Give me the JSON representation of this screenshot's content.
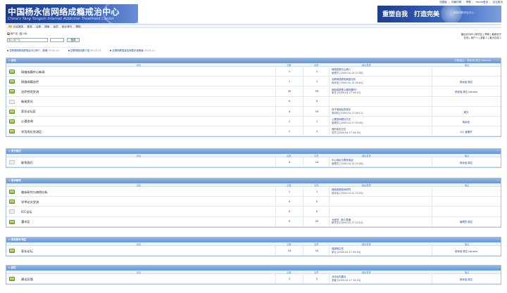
{
  "header": {
    "top_links": [
      "无图版",
      "风格切换",
      "帮助",
      "Home首页",
      "论坛首页"
    ],
    "banner_title": "中国杨永信网络成瘾戒治中心",
    "banner_subtitle": "China's Yang Yongxin Internet Addiction Treatment Center",
    "slogan_main": "重塑自我　打造完美",
    "slogan_small": "网络成瘾戒治中心"
  },
  "nav": {
    "items": [
      "社区服务",
      "登录",
      "注册",
      "搜索",
      "会员",
      "统计排行",
      "帮助"
    ]
  },
  "login": {
    "radio_user": "用户名",
    "radio_uid": "UID",
    "username_placeholder": "输入用户名",
    "login_button": "登录"
  },
  "stats": {
    "line1": "最后访问IP:| 精华区 | 帮助 | 最新帖子",
    "line2": "在线 | 用户 0 | 游客 1 | 最大在线 1"
  },
  "announcements": [
    {
      "text": "互联网网络成瘾戒治中心简介，新增",
      "date": "09-04-13"
    },
    {
      "text": "互联网络成瘾介绍",
      "date": "09-04-13"
    },
    {
      "text": "互联网瘾患者及家属必读报道",
      "date": "09-04-13"
    }
  ],
  "columns": {
    "forum": "论坛",
    "topics": "主题",
    "posts": "文章",
    "last_post": "最后发表",
    "moderator": "版主"
  },
  "sections": [
    {
      "title": "» 论坛",
      "mods": "分类版主：杨永信 周文 hahaha",
      "rows": [
        {
          "icon": "new",
          "name": "网络成瘾中心新闻",
          "topics": "1",
          "posts": "1",
          "last_title": "网络成瘾中心简介",
          "last_by": "管理员 [2009-04-13 15:58]",
          "moderator": ""
        },
        {
          "icon": "new",
          "name": "网络成瘾治疗",
          "topics": "1",
          "posts": "1",
          "last_title": "互联网成瘾的病因分析",
          "last_by": "杨永信 [2009-04-13 16:02]",
          "moderator": "杨永信 周文"
        },
        {
          "icon": "new",
          "name": "治疗经验交流",
          "topics": "32",
          "posts": "53",
          "last_title": "网络成瘾是心理问题吗？",
          "last_by": "家长 [2009-04-17 09:25]",
          "moderator": "杨永信 周文 hahaha"
        },
        {
          "icon": "old",
          "name": "新闻资讯",
          "topics": "0",
          "posts": "0",
          "last_title": "",
          "last_by": "",
          "moderator": ""
        },
        {
          "icon": "new",
          "name": "家长论坛区",
          "topics": "4",
          "posts": "19",
          "last_title": "孩子戒网后的变化",
          "last_by": "张妈妈 [2009-04-17 08:11]",
          "moderator": "周文"
        },
        {
          "icon": "new",
          "name": "心理咨询",
          "topics": "1",
          "posts": "1",
          "last_title": "心理咨询预约方式",
          "last_by": "管理员 [2009-04-17 09:00]",
          "moderator": "杨永信"
        },
        {
          "icon": "new",
          "name": "学员成长交流区",
          "topics": "1",
          "posts": "1",
          "last_title": "我的成长日记",
          "last_by": "学员 [2009-04-17 09:30]",
          "moderator": "ICC 管理员"
        }
      ]
    },
    {
      "title": "» 关于我们",
      "mods": "",
      "rows": [
        {
          "icon": "old",
          "name": "联系我们",
          "topics": "4",
          "posts": "14",
          "last_title": "中心地址与联系电话",
          "last_by": "管理员 [2009-04-13 15:58]",
          "moderator": "杨永信 周文"
        }
      ]
    },
    {
      "title": "» 学术研究",
      "mods": "",
      "rows": [
        {
          "icon": "new",
          "name": "临床研究与病例分析",
          "topics": "1",
          "posts": "1",
          "last_title": "网络成瘾临床研究",
          "last_by": "杨永信 [2009-04-13 15:55]",
          "moderator": ""
        },
        {
          "icon": "new",
          "name": "学术论文交流",
          "topics": "0",
          "posts": "0",
          "last_title": "",
          "last_by": "",
          "moderator": ""
        },
        {
          "icon": "old",
          "name": "ICC论坛",
          "topics": "0",
          "posts": "0",
          "last_title": "",
          "last_by": "",
          "moderator": ""
        },
        {
          "icon": "new",
          "name": "灌水区",
          "topics": "5",
          "posts": "22",
          "last_title": "大家好，新人报道",
          "last_by": "新学员 [2009-04-17 10:15]",
          "moderator": "管理员 周文"
        }
      ]
    },
    {
      "title": "» 学员家长专区",
      "mods": "",
      "rows": [
        {
          "icon": "new",
          "name": "家长论坛",
          "topics": "10",
          "posts": "10",
          "last_title": "感谢杨主任",
          "last_by": "家长 [2009-04-17 09:48]",
          "moderator": "杨永信 周文 hahaha"
        }
      ]
    },
    {
      "title": "» 其它",
      "mods": "",
      "rows": [
        {
          "icon": "new",
          "name": "建议反馈",
          "topics": "1",
          "posts": "2",
          "last_title": "对论坛的建议",
          "last_by": "游客 [2009-04-17 10:20]",
          "moderator": "杨永信 周文"
        }
      ]
    }
  ]
}
